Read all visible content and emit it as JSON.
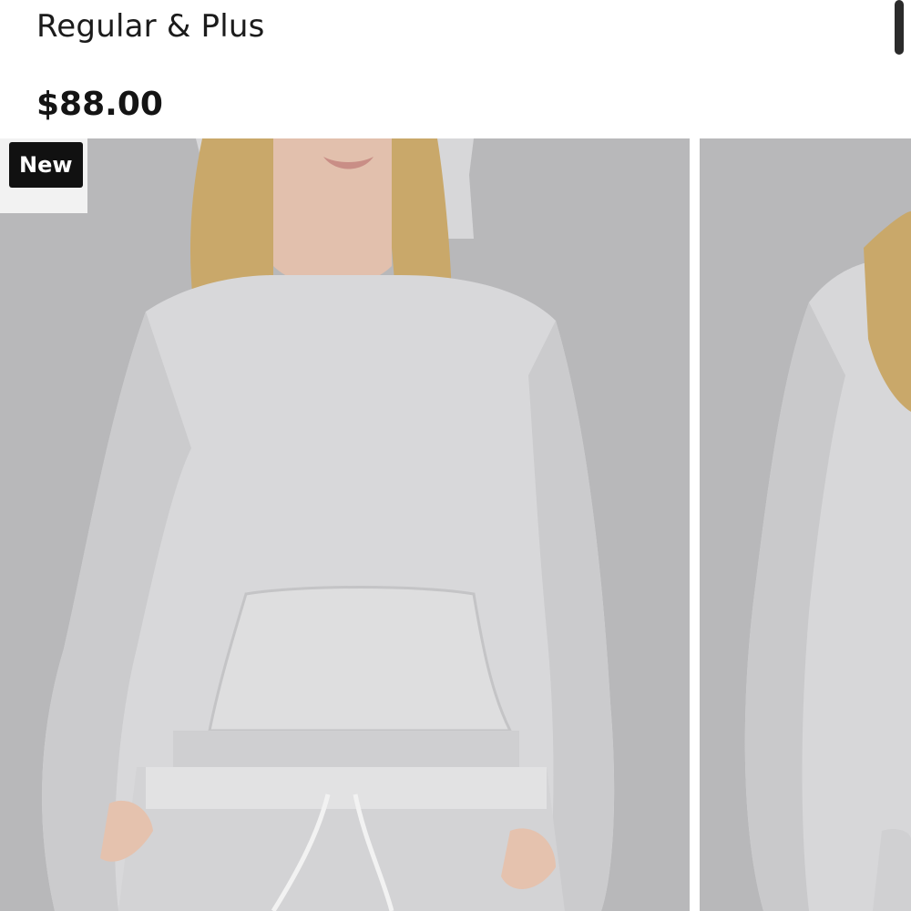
{
  "product": {
    "size_range": "Regular & Plus",
    "price": "$88.00",
    "badge": "New"
  },
  "gallery": {
    "images": [
      {
        "name": "product-image-1",
        "subject": "woman wearing heather gray oversized hoodie and sweatpants"
      },
      {
        "name": "product-image-2",
        "subject": "side view of heather gray hoodie"
      }
    ]
  },
  "colors": {
    "background": "#ffffff",
    "photo_backdrop": "#b8b8ba",
    "garment_gray": "#d9d9db",
    "badge_bg": "#111111",
    "badge_text": "#ffffff",
    "text": "#1b1b1b"
  },
  "icons": {
    "scrollbar": "scrollbar-thumb"
  }
}
